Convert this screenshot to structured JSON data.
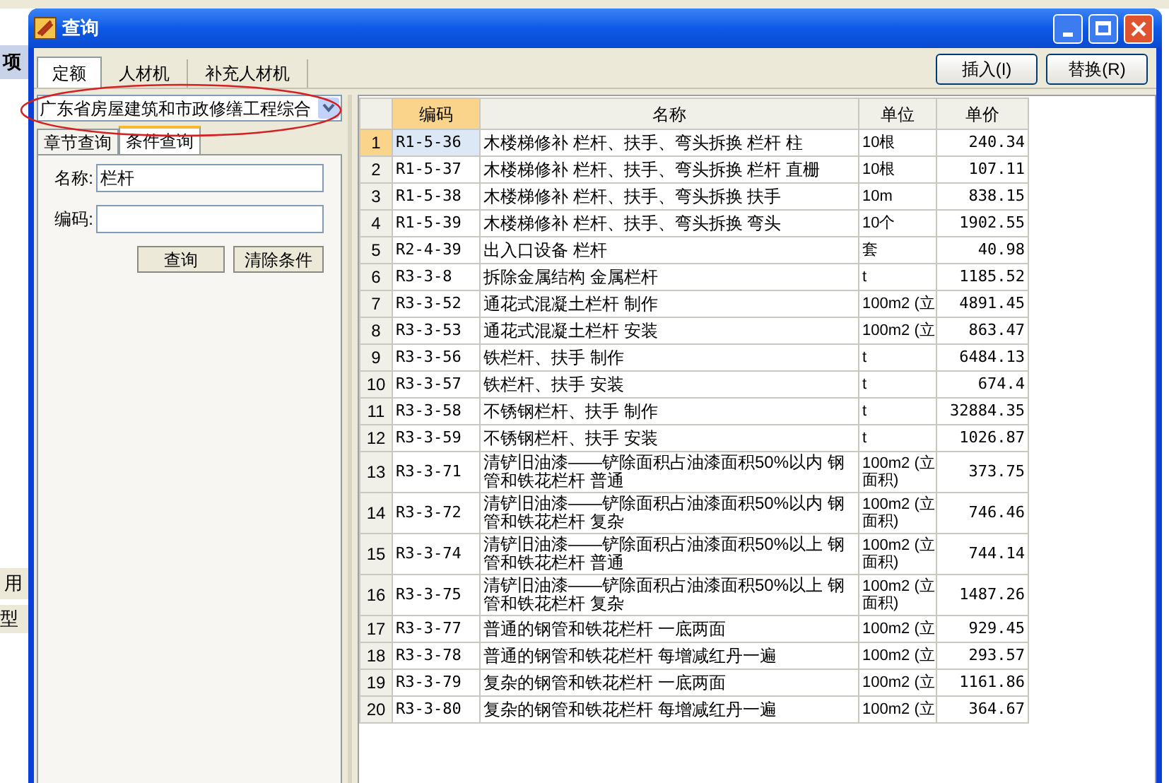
{
  "background": {
    "fragments": [
      "项",
      "用",
      "型"
    ]
  },
  "window": {
    "title": "查询"
  },
  "tabs": [
    {
      "label": "定额",
      "selected": true
    },
    {
      "label": "人材机",
      "selected": false
    },
    {
      "label": "补充人材机",
      "selected": false
    }
  ],
  "actions": [
    "插入(I)",
    "替换(R)"
  ],
  "library": {
    "value": "广东省房屋建筑和市政修缮工程综合"
  },
  "subtabs": [
    {
      "label": "章节查询",
      "selected": false
    },
    {
      "label": "条件查询",
      "selected": true
    }
  ],
  "fields": [
    {
      "label": "名称:",
      "value": "栏杆"
    },
    {
      "label": "编码:"
    }
  ],
  "search_buttons": [
    "查询",
    "清除条件"
  ],
  "table": {
    "columns": [
      "编码",
      "名称",
      "单位",
      "单价"
    ],
    "rows": [
      {
        "num": "1",
        "code": "R1-5-36",
        "name": "木楼梯修补 栏杆、扶手、弯头拆换 栏杆 柱",
        "unit": "10根",
        "price": "240.34",
        "selected": true
      },
      {
        "num": "2",
        "code": "R1-5-37",
        "name": "木楼梯修补 栏杆、扶手、弯头拆换 栏杆 直栅",
        "unit": "10根",
        "price": "107.11",
        "selected": false
      },
      {
        "num": "3",
        "code": "R1-5-38",
        "name": "木楼梯修补 栏杆、扶手、弯头拆换 扶手",
        "unit": "10m",
        "price": "838.15",
        "selected": false
      },
      {
        "num": "4",
        "code": "R1-5-39",
        "name": "木楼梯修补 栏杆、扶手、弯头拆换 弯头",
        "unit": "10个",
        "price": "1902.55",
        "selected": false
      },
      {
        "num": "5",
        "code": "R2-4-39",
        "name": "出入口设备 栏杆",
        "unit": "套",
        "price": "40.98",
        "selected": false
      },
      {
        "num": "6",
        "code": "R3-3-8",
        "name": "拆除金属结构 金属栏杆",
        "unit": "t",
        "price": "1185.52",
        "selected": false
      },
      {
        "num": "7",
        "code": "R3-3-52",
        "name": "通花式混凝土栏杆 制作",
        "unit": "100m2 (立",
        "price": "4891.45",
        "selected": false
      },
      {
        "num": "8",
        "code": "R3-3-53",
        "name": "通花式混凝土栏杆 安装",
        "unit": "100m2 (立",
        "price": "863.47",
        "selected": false
      },
      {
        "num": "9",
        "code": "R3-3-56",
        "name": "铁栏杆、扶手 制作",
        "unit": "t",
        "price": "6484.13",
        "selected": false
      },
      {
        "num": "10",
        "code": "R3-3-57",
        "name": "铁栏杆、扶手 安装",
        "unit": "t",
        "price": "674.4",
        "selected": false
      },
      {
        "num": "11",
        "code": "R3-3-58",
        "name": "不锈钢栏杆、扶手 制作",
        "unit": "t",
        "price": "32884.35",
        "selected": false
      },
      {
        "num": "12",
        "code": "R3-3-59",
        "name": "不锈钢栏杆、扶手 安装",
        "unit": "t",
        "price": "1026.87",
        "selected": false
      },
      {
        "num": "13",
        "code": "R3-3-71",
        "name": "清铲旧油漆——铲除面积占油漆面积50%以内 钢管和铁花栏杆 普通",
        "unit": "100m2 (立面积)",
        "price": "373.75",
        "selected": false
      },
      {
        "num": "14",
        "code": "R3-3-72",
        "name": "清铲旧油漆——铲除面积占油漆面积50%以内 钢管和铁花栏杆 复杂",
        "unit": "100m2 (立面积)",
        "price": "746.46",
        "selected": false
      },
      {
        "num": "15",
        "code": "R3-3-74",
        "name": "清铲旧油漆——铲除面积占油漆面积50%以上 钢管和铁花栏杆 普通",
        "unit": "100m2 (立面积)",
        "price": "744.14",
        "selected": false
      },
      {
        "num": "16",
        "code": "R3-3-75",
        "name": "清铲旧油漆——铲除面积占油漆面积50%以上 钢管和铁花栏杆 复杂",
        "unit": "100m2 (立面积)",
        "price": "1487.26",
        "selected": false
      },
      {
        "num": "17",
        "code": "R3-3-77",
        "name": "普通的钢管和铁花栏杆 一底两面",
        "unit": "100m2 (立",
        "price": "929.45",
        "selected": false
      },
      {
        "num": "18",
        "code": "R3-3-78",
        "name": "普通的钢管和铁花栏杆 每增减红丹一遍",
        "unit": "100m2 (立",
        "price": "293.57",
        "selected": false
      },
      {
        "num": "19",
        "code": "R3-3-79",
        "name": "复杂的钢管和铁花栏杆 一底两面",
        "unit": "100m2 (立",
        "price": "1161.86",
        "selected": false
      },
      {
        "num": "20",
        "code": "R3-3-80",
        "name": "复杂的钢管和铁花栏杆 每增减红丹一遍",
        "unit": "100m2 (立",
        "price": "364.67",
        "selected": false
      }
    ]
  }
}
